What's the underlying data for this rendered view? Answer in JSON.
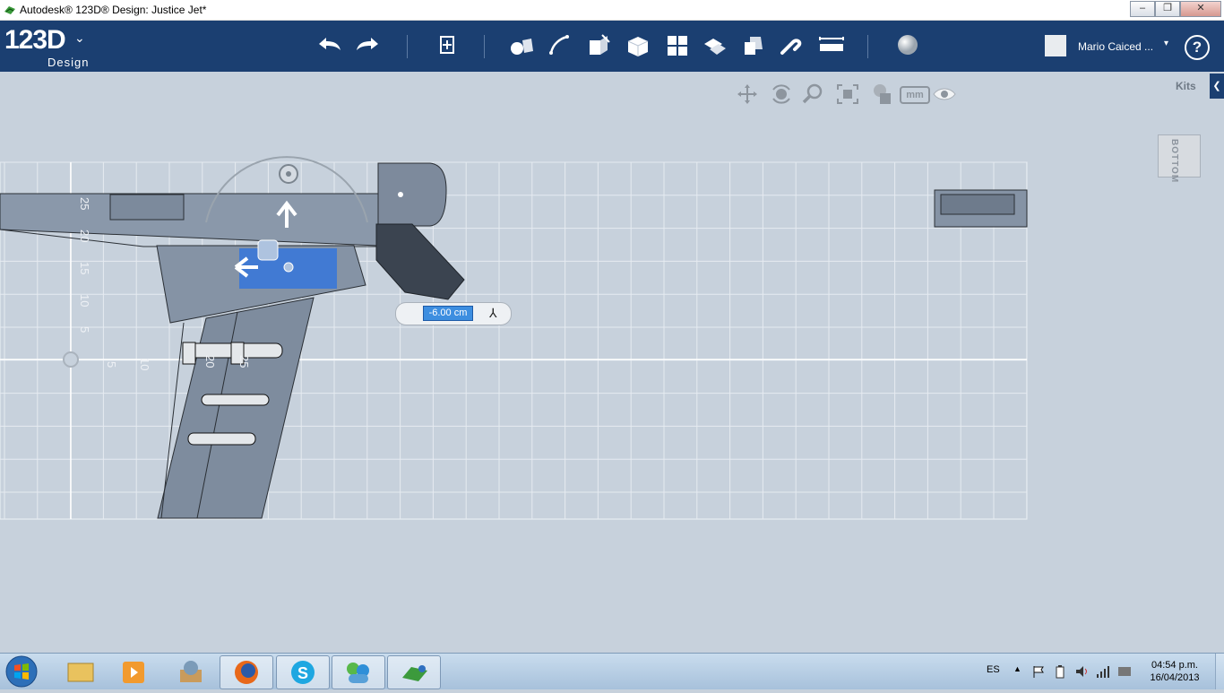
{
  "window": {
    "title": "Autodesk® 123D® Design: Justice Jet*",
    "app_icon": "123d-app-icon",
    "minimize": "–",
    "maximize": "❐",
    "close": "✕"
  },
  "toolbar": {
    "logo_main": "123D",
    "logo_sub": "Design",
    "logo_menu": "⌄",
    "tools": [
      {
        "name": "undo-icon"
      },
      {
        "name": "redo-icon"
      },
      {
        "name": "transform-icon"
      },
      {
        "name": "primitives-icon"
      },
      {
        "name": "sketch-icon"
      },
      {
        "name": "construct-icon"
      },
      {
        "name": "modify-icon"
      },
      {
        "name": "pattern-icon"
      },
      {
        "name": "grouping-icon"
      },
      {
        "name": "combine-icon"
      },
      {
        "name": "snap-icon"
      },
      {
        "name": "measure-icon"
      },
      {
        "name": "material-icon"
      }
    ],
    "user_name": "Mario Caiced ...",
    "user_dropdown": "▾",
    "help": "?",
    "accent": "#1b3f71"
  },
  "viewport": {
    "kits_label": "Kits",
    "kits_tab": "❮",
    "viewcube_face": "BOTTOM",
    "units_label": "mm",
    "ruler_labels_vertical": [
      "25",
      "20",
      "15",
      "10",
      "5"
    ],
    "ruler_labels_horizontal": [
      "5",
      "10",
      "20",
      "25"
    ],
    "dimension_value": "-6.00 cm",
    "background": "#c7d1dc",
    "selection_color": "#3a78d8"
  },
  "taskbar": {
    "apps": [
      {
        "name": "windows-explorer-icon"
      },
      {
        "name": "media-player-icon"
      },
      {
        "name": "app-icon-3"
      },
      {
        "name": "firefox-icon"
      },
      {
        "name": "skype-icon"
      },
      {
        "name": "messenger-icon"
      },
      {
        "name": "123d-design-icon"
      }
    ],
    "language": "ES",
    "time": "04:54 p.m.",
    "date": "16/04/2013"
  }
}
